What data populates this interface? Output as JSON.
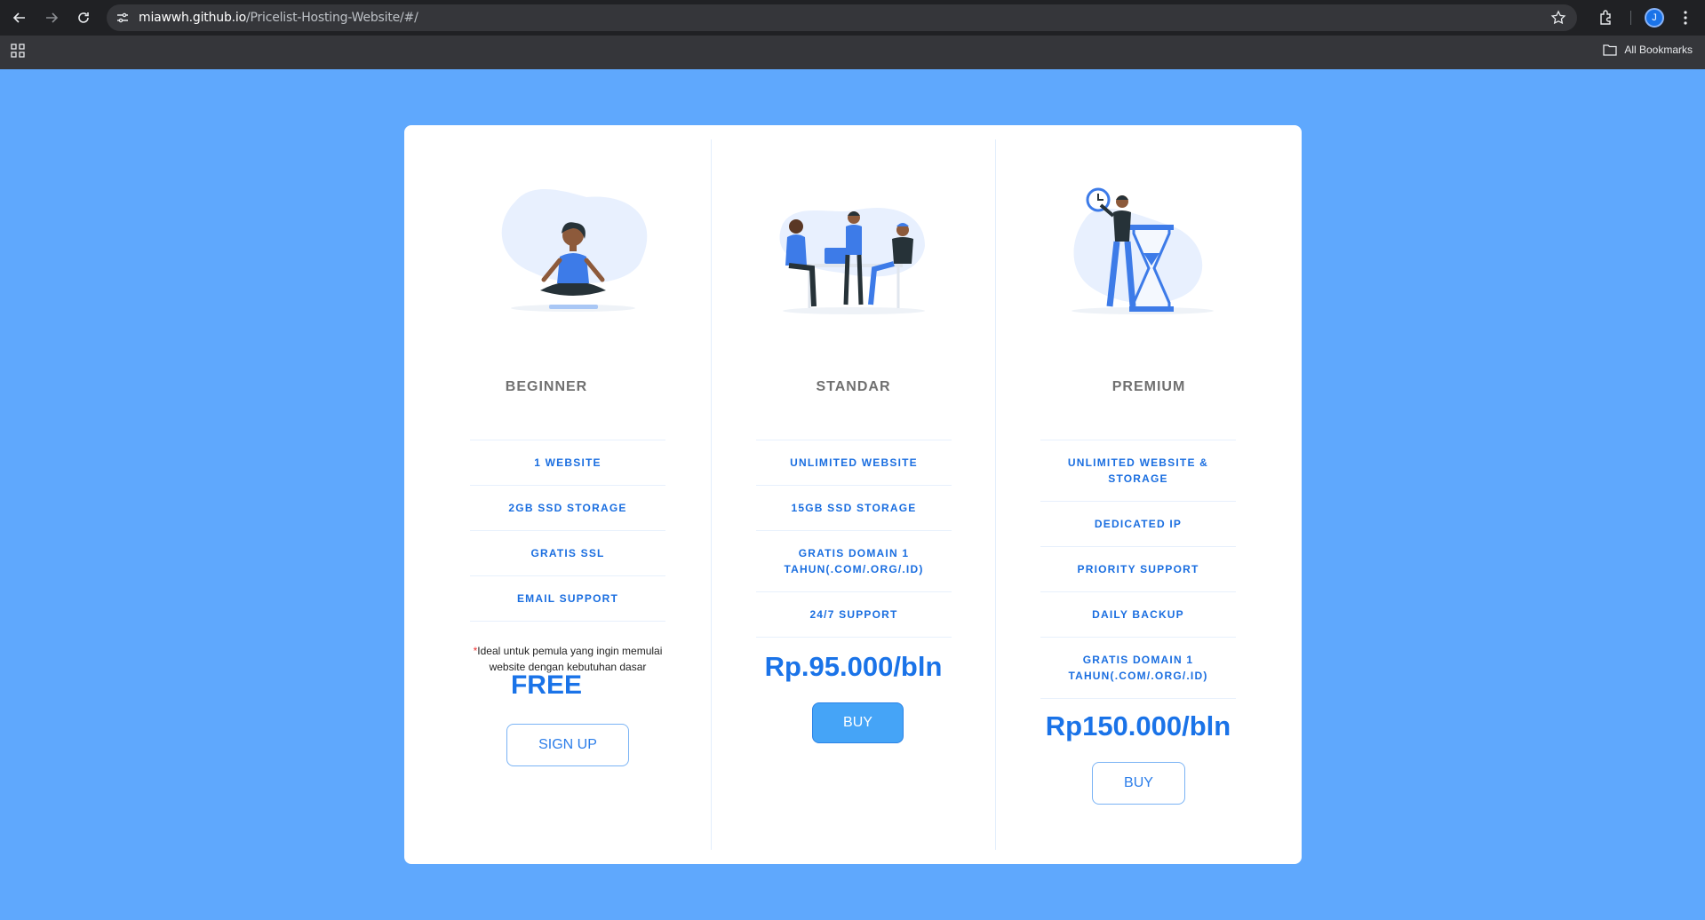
{
  "browser": {
    "url_host": "miawwh.github.io",
    "url_path": "/Pricelist-Hosting-Website/#/",
    "avatar_letter": "J",
    "bookmarks_label": "All Bookmarks"
  },
  "plans": [
    {
      "name": "BEGINNER",
      "features": [
        "1 WEBSITE",
        "2GB SSD STORAGE",
        "GRATIS SSL",
        "EMAIL SUPPORT"
      ],
      "note_asterisk": "*",
      "note": "Ideal untuk pemula yang ingin memulai website dengan kebutuhan dasar",
      "price": "FREE",
      "button": "SIGN UP"
    },
    {
      "name": "STANDAR",
      "features": [
        "UNLIMITED WEBSITE",
        "15GB SSD STORAGE",
        "GRATIS DOMAIN 1 TAHUN(.COM/.ORG/.ID)",
        "24/7 SUPPORT"
      ],
      "price": "Rp.95.000/bln",
      "button": "BUY"
    },
    {
      "name": "PREMIUM",
      "features": [
        "UNLIMITED WEBSITE & STORAGE",
        "DEDICATED IP",
        "PRIORITY SUPPORT",
        "DAILY BACKUP",
        "GRATIS DOMAIN 1 TAHUN(.COM/.ORG/.ID)"
      ],
      "price": "Rp150.000/bln",
      "button": "BUY"
    }
  ],
  "colors": {
    "background": "#5fa8fd",
    "accent": "#1a73e8",
    "feature_text": "#1a6ee0",
    "illustration_blob": "#e8f0fe",
    "illustration_primary": "#3d7be8"
  }
}
